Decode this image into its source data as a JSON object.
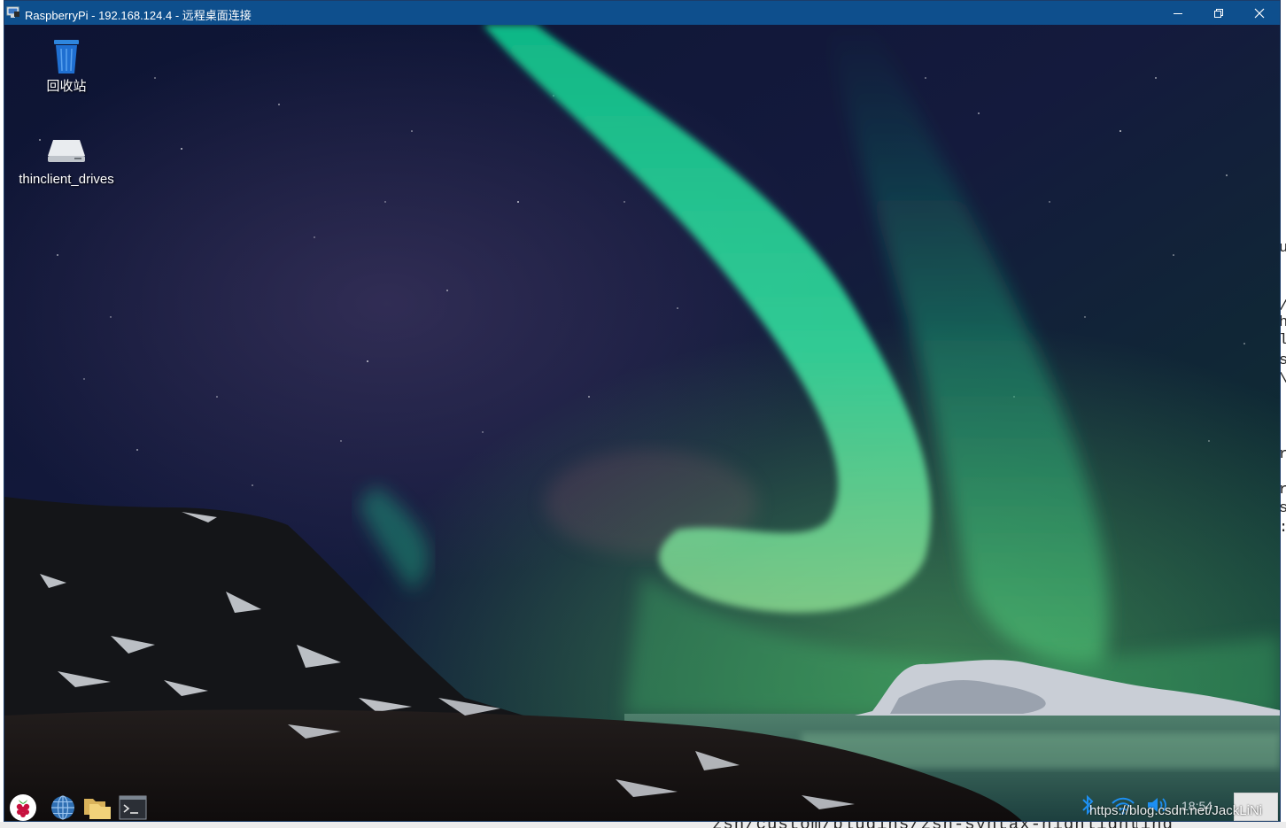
{
  "window": {
    "title": "RaspberryPi - 192.168.124.4 - 远程桌面连接",
    "minimize_icon": "minimize-icon",
    "restore_icon": "restore-icon",
    "close_icon": "close-icon"
  },
  "desktop": {
    "icons": [
      {
        "label": "回收站",
        "icon": "recycle-bin-icon"
      },
      {
        "label": "thinclient_drives",
        "icon": "drive-icon"
      }
    ]
  },
  "taskbar": {
    "launchers": [
      {
        "icon": "raspberry-menu-icon"
      },
      {
        "icon": "web-browser-icon"
      },
      {
        "icon": "file-manager-icon"
      },
      {
        "icon": "terminal-icon"
      }
    ],
    "tray": {
      "bluetooth_icon": "bluetooth-icon",
      "wifi_icon": "wifi-icon",
      "volume_icon": "volume-icon",
      "clock": "18:54"
    }
  },
  "watermark": "https://blog.csdn.net/JackLiNi",
  "background_terminal": {
    "right_edge_glyphs": [
      "u",
      "/",
      "h",
      "l",
      "s",
      "\\",
      "r",
      "r",
      "s",
      ":"
    ],
    "bottom_line": "zsh/custom/plugins/zsh-syntax-highlighting"
  },
  "colors": {
    "titlebar": "#0e4f8d",
    "aurora_green": "#20e39a",
    "sky": "#0b1230"
  }
}
